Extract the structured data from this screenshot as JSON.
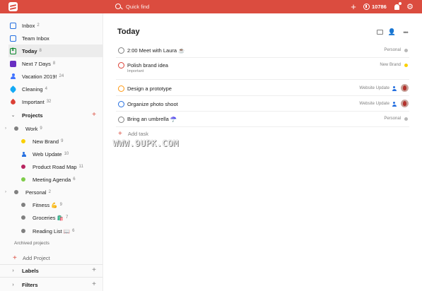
{
  "topbar": {
    "search_placeholder": "Quick find",
    "karma_count": "10786",
    "brand_color": "#db4c3f"
  },
  "sidebar": {
    "nav": [
      {
        "label": "Inbox",
        "count": "2",
        "icon": "inbox-icon"
      },
      {
        "label": "Team Inbox",
        "count": "",
        "icon": "team-inbox-icon"
      },
      {
        "label": "Today",
        "count": "8",
        "icon": "today-icon"
      },
      {
        "label": "Next 7 Days",
        "count": "8",
        "icon": "calendar-icon"
      },
      {
        "label": "Vacation 2019!",
        "count": "24",
        "icon": "person-icon"
      },
      {
        "label": "Cleaning",
        "count": "4",
        "icon": "tag-icon"
      },
      {
        "label": "Important",
        "count": "32",
        "icon": "drop-icon"
      }
    ],
    "projects_label": "Projects",
    "projects": [
      {
        "label": "Work",
        "count": "9",
        "color": "#808080"
      },
      {
        "label": "New Brand",
        "count": "9",
        "color": "#fad000"
      },
      {
        "label": "Web Update",
        "count": "10",
        "color": "#246fe0"
      },
      {
        "label": "Product Road Map",
        "count": "11",
        "color": "#b8255f"
      },
      {
        "label": "Meeting Agenda",
        "count": "6",
        "color": "#7ecc49"
      },
      {
        "label": "Personal",
        "count": "2",
        "color": "#808080"
      },
      {
        "label": "Fitness 💪",
        "count": "9",
        "color": "#808080"
      },
      {
        "label": "Groceries 🛍️",
        "count": "7",
        "color": "#808080"
      },
      {
        "label": "Reading List 📖",
        "count": "6",
        "color": "#808080"
      }
    ],
    "archived_label": "Archived projects",
    "add_project_label": "Add Project",
    "labels_label": "Labels",
    "filters_label": "Filters"
  },
  "main": {
    "title": "Today",
    "tasks": [
      {
        "title": "2:00 Meet with Laura ☕",
        "project": "Personal",
        "project_color": "#b8b8b8",
        "check_color": "#808080"
      },
      {
        "title": "Polish brand idea",
        "sub": "Important",
        "project": "New Brand",
        "project_color": "#fad000",
        "check_color": "#db4035"
      },
      {
        "title": "Design a prototype",
        "project": "Website Update",
        "project_color": "#246fe0",
        "check_color": "#ff9a14"
      },
      {
        "title": "Organize photo shoot",
        "project": "Website Update",
        "project_color": "#246fe0",
        "check_color": "#246fe0"
      },
      {
        "title": "Bring an umbrella ☂️",
        "project": "Personal",
        "project_color": "#b8b8b8",
        "check_color": "#808080"
      }
    ],
    "add_task_label": "Add task"
  },
  "watermark": "WWW.9UPK.COM"
}
